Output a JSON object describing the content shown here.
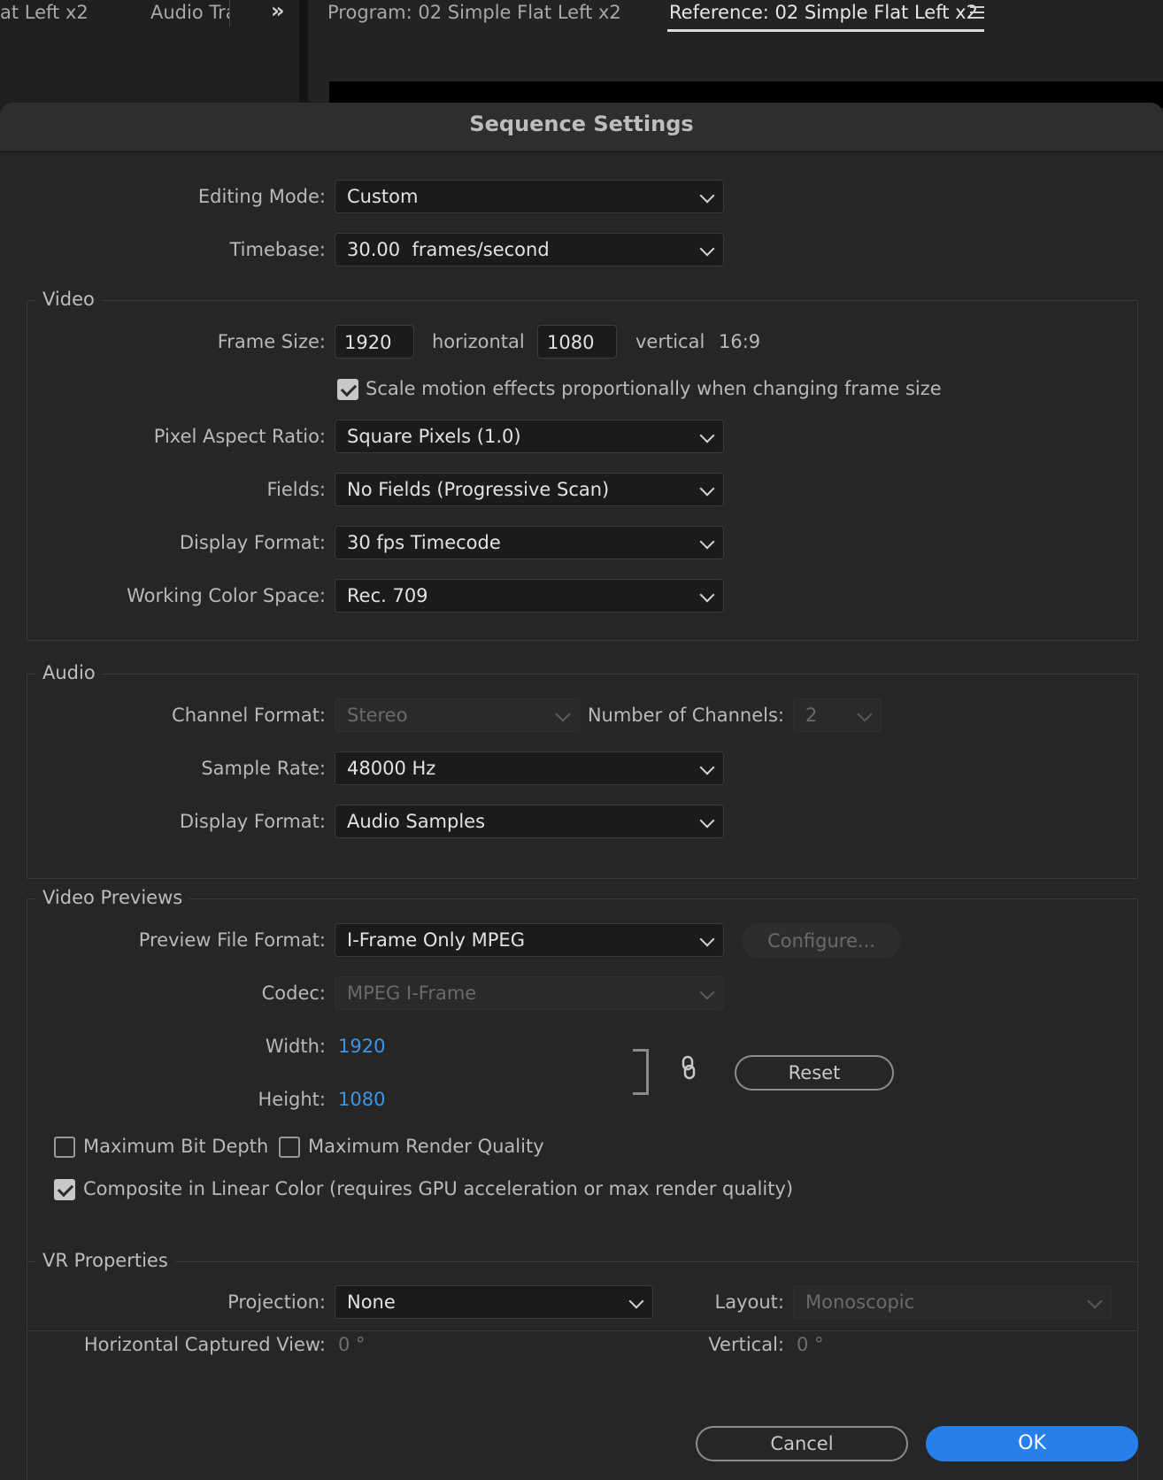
{
  "tabs": {
    "left1": "at Left x2",
    "left2": "Audio Tra",
    "overflow_icon": "double-chevron-right-icon",
    "program": "Program: 02 Simple Flat Left x2",
    "reference": "Reference: 02 Simple Flat Left x2",
    "menu_icon": "hamburger-menu-icon"
  },
  "dialog": {
    "title": "Sequence Settings",
    "editing_mode": {
      "label": "Editing Mode:",
      "value": "Custom"
    },
    "timebase": {
      "label": "Timebase:",
      "value": "30.00  frames/second"
    },
    "video": {
      "title": "Video",
      "frame_size": {
        "label": "Frame Size:",
        "width": "1920",
        "horizontal": "horizontal",
        "height": "1080",
        "vertical": "vertical",
        "aspect": "16:9"
      },
      "scale_motion": {
        "label": "Scale motion effects proportionally when changing frame size",
        "checked": true
      },
      "pixel_aspect": {
        "label": "Pixel Aspect Ratio:",
        "value": "Square Pixels (1.0)"
      },
      "fields": {
        "label": "Fields:",
        "value": "No Fields (Progressive Scan)"
      },
      "display_format": {
        "label": "Display Format:",
        "value": "30 fps Timecode"
      },
      "color_space": {
        "label": "Working Color Space:",
        "value": "Rec. 709"
      }
    },
    "audio": {
      "title": "Audio",
      "channel_format": {
        "label": "Channel Format:",
        "value": "Stereo"
      },
      "num_channels": {
        "label": "Number of Channels:",
        "value": "2"
      },
      "sample_rate": {
        "label": "Sample Rate:",
        "value": "48000 Hz"
      },
      "display_format": {
        "label": "Display Format:",
        "value": "Audio Samples"
      }
    },
    "previews": {
      "title": "Video Previews",
      "file_format": {
        "label": "Preview File Format:",
        "value": "I-Frame Only MPEG"
      },
      "configure": "Configure...",
      "codec": {
        "label": "Codec:",
        "value": "MPEG I-Frame"
      },
      "width": {
        "label": "Width:",
        "value": "1920"
      },
      "height": {
        "label": "Height:",
        "value": "1080"
      },
      "reset": "Reset",
      "max_bit_depth": {
        "label": "Maximum Bit Depth",
        "checked": false
      },
      "max_render_quality": {
        "label": "Maximum Render Quality",
        "checked": false
      },
      "composite_linear": {
        "label": "Composite in Linear Color (requires GPU acceleration or max render quality)",
        "checked": true
      }
    },
    "vr": {
      "title": "VR Properties",
      "projection": {
        "label": "Projection:",
        "value": "None"
      },
      "layout": {
        "label": "Layout:",
        "value": "Monoscopic"
      },
      "h_view": {
        "label": "Horizontal Captured View:",
        "value": "0 °"
      },
      "vertical": {
        "label": "Vertical:",
        "value": "0 °"
      }
    },
    "cancel": "Cancel",
    "ok": "OK"
  },
  "colors": {
    "accent": "#2680eb",
    "link_value": "#3d95e6",
    "background": "#262626"
  }
}
